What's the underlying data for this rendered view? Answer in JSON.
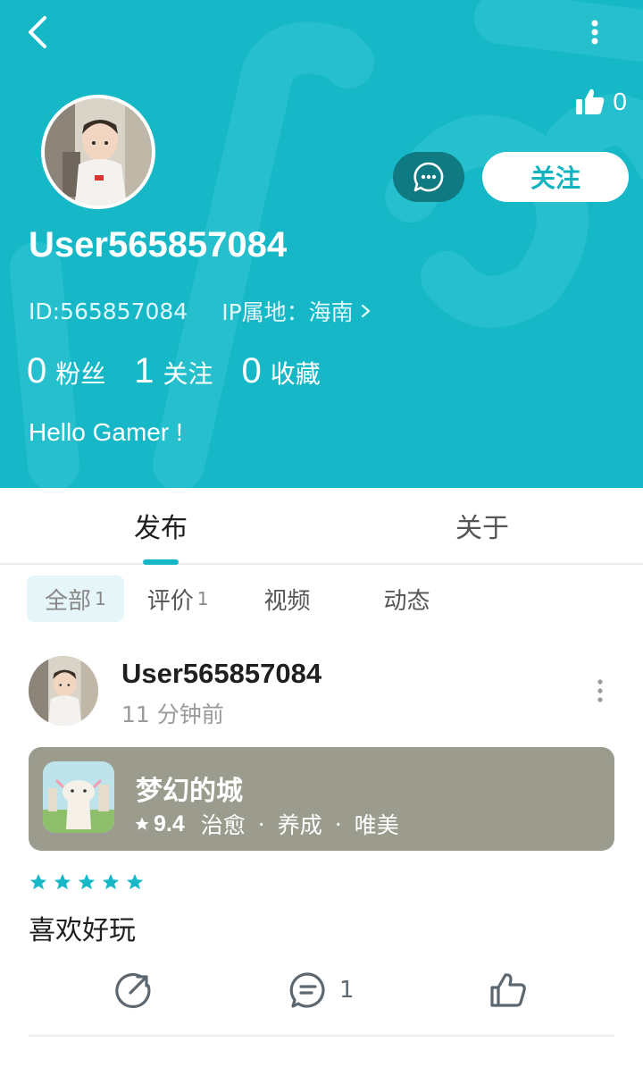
{
  "header": {
    "like_count": "0",
    "follow_label": "关注",
    "username": "User565857084",
    "id_text": "ID:565857084",
    "ip_label": "IP属地：",
    "ip_value": "海南",
    "stats": [
      {
        "count": "0",
        "label": "粉丝"
      },
      {
        "count": "1",
        "label": "关注"
      },
      {
        "count": "0",
        "label": "收藏"
      }
    ],
    "bio": "Hello Gamer !"
  },
  "tabs": [
    {
      "label": "发布",
      "active": true
    },
    {
      "label": "关于",
      "active": false
    }
  ],
  "filters": [
    {
      "label": "全部",
      "count": "1",
      "active": true
    },
    {
      "label": "评价",
      "count": "1",
      "active": false
    },
    {
      "label": "视频",
      "count": "",
      "active": false
    },
    {
      "label": "动态",
      "count": "",
      "active": false
    }
  ],
  "post": {
    "username": "User565857084",
    "time": "11 分钟前",
    "game": {
      "title": "梦幻的城",
      "score": "9.4",
      "tags": [
        "治愈",
        "养成",
        "唯美"
      ]
    },
    "rating_stars": 5,
    "text": "喜欢好玩",
    "comment_count": "1"
  },
  "colors": {
    "accent": "#16b8c8",
    "message_button": "#0f7a82",
    "game_card": "#9b9c8e"
  },
  "icons": [
    "back-arrow-icon",
    "more-vertical-icon",
    "thumbs-up-icon",
    "chat-bubble-icon",
    "chevron-right-icon",
    "star-icon",
    "share-icon",
    "comment-icon"
  ]
}
